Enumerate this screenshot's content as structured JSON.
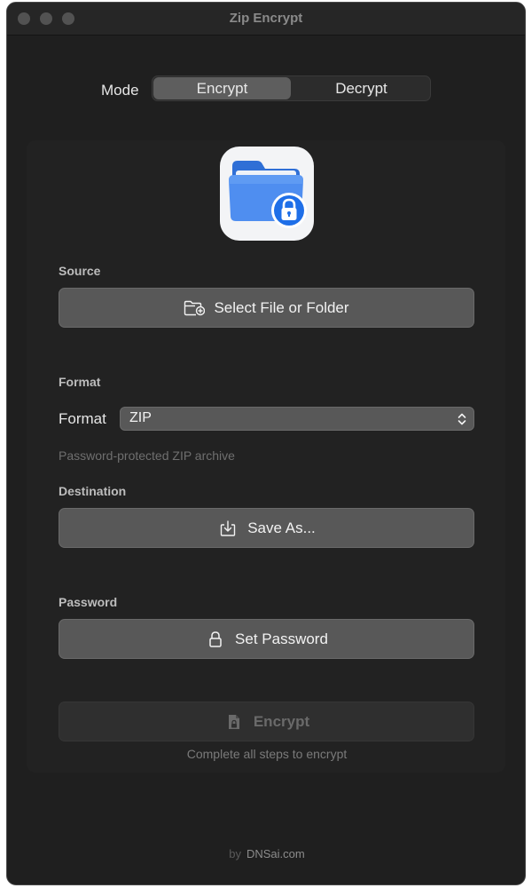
{
  "window": {
    "title": "Zip Encrypt"
  },
  "mode": {
    "label": "Mode",
    "options": [
      "Encrypt",
      "Decrypt"
    ],
    "selected": "Encrypt"
  },
  "app_icon": "folder-lock-icon",
  "source": {
    "label": "Source",
    "button_label": "Select File or Folder",
    "icon": "folder-add-icon"
  },
  "format": {
    "section_label": "Format",
    "field_label": "Format",
    "selected_value": "ZIP",
    "hint": "Password-protected ZIP archive"
  },
  "destination": {
    "label": "Destination",
    "button_label": "Save As...",
    "icon": "download-tray-icon"
  },
  "password": {
    "label": "Password",
    "button_label": "Set Password",
    "icon": "lock-icon"
  },
  "action": {
    "button_label": "Encrypt",
    "icon": "locked-document-icon",
    "caption": "Complete all steps to encrypt",
    "enabled": false
  },
  "footer": {
    "by": "by",
    "brand": "DNSai.com"
  },
  "colors": {
    "window_bg": "#1f1f1f",
    "button_bg": "#585858",
    "segment_selected_bg": "#5e5e5e",
    "icon_blue": "#3b82f6"
  }
}
